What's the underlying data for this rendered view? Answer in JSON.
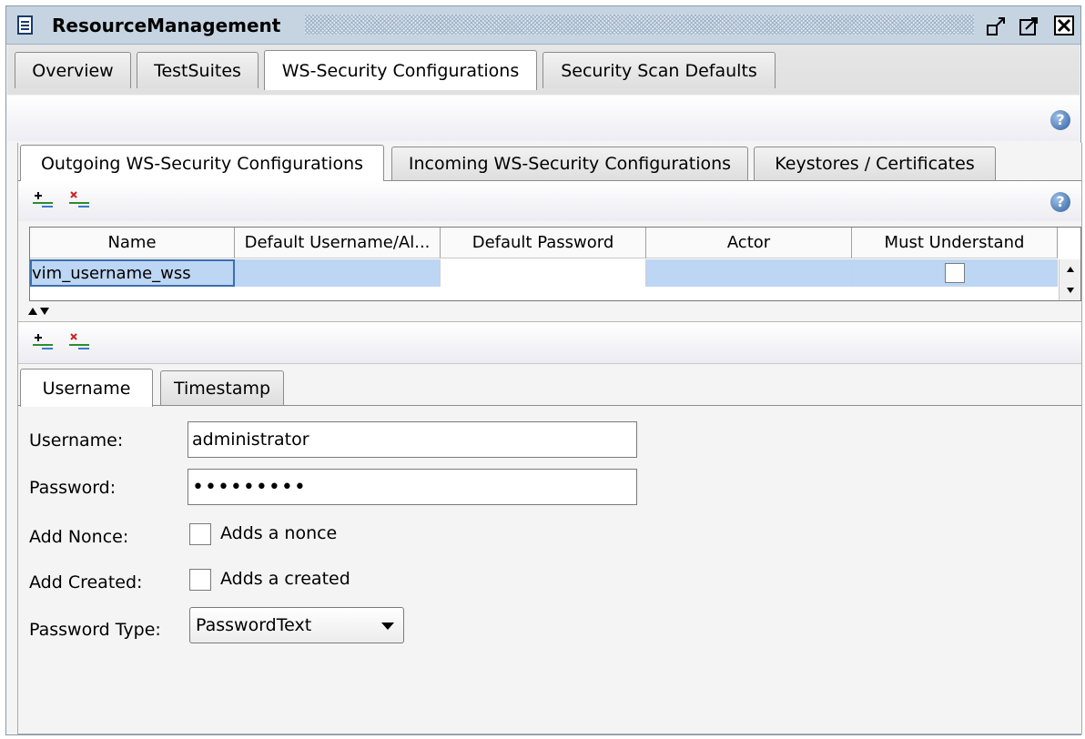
{
  "window": {
    "title": "ResourceManagement",
    "controls": [
      "minimize-icon",
      "maximize-icon",
      "close-icon"
    ]
  },
  "tabs": [
    {
      "label": "Overview",
      "active": false
    },
    {
      "label": "TestSuites",
      "active": false
    },
    {
      "label": "WS-Security Configurations",
      "active": true
    },
    {
      "label": "Security Scan Defaults",
      "active": false
    }
  ],
  "subtabs": [
    {
      "label": "Outgoing WS-Security Configurations",
      "active": true
    },
    {
      "label": "Incoming WS-Security Configurations",
      "active": false
    },
    {
      "label": "Keystores / Certificates",
      "active": false
    }
  ],
  "table": {
    "columns": [
      "Name",
      "Default Username/Al...",
      "Default Password",
      "Actor",
      "Must Understand"
    ],
    "rows": [
      {
        "name": "vim_username_wss",
        "username": "",
        "password": "",
        "actor": "",
        "must_understand": false
      }
    ]
  },
  "entry_tabs": [
    {
      "label": "Username",
      "active": true
    },
    {
      "label": "Timestamp",
      "active": false
    }
  ],
  "form": {
    "username_label": "Username:",
    "username_value": "administrator",
    "password_label": "Password:",
    "password_value": "•••••••••",
    "nonce_label": "Add Nonce:",
    "nonce_text": "Adds a nonce",
    "nonce_checked": false,
    "created_label": "Add Created:",
    "created_text": "Adds a created",
    "created_checked": false,
    "pwtype_label": "Password Type:",
    "pwtype_value": "PasswordText"
  },
  "colors": {
    "titlebar": "#c6d4e2",
    "selection": "#bcd6f4",
    "add_icon": "#2e8b2e",
    "remove_icon": "#cc2222"
  }
}
